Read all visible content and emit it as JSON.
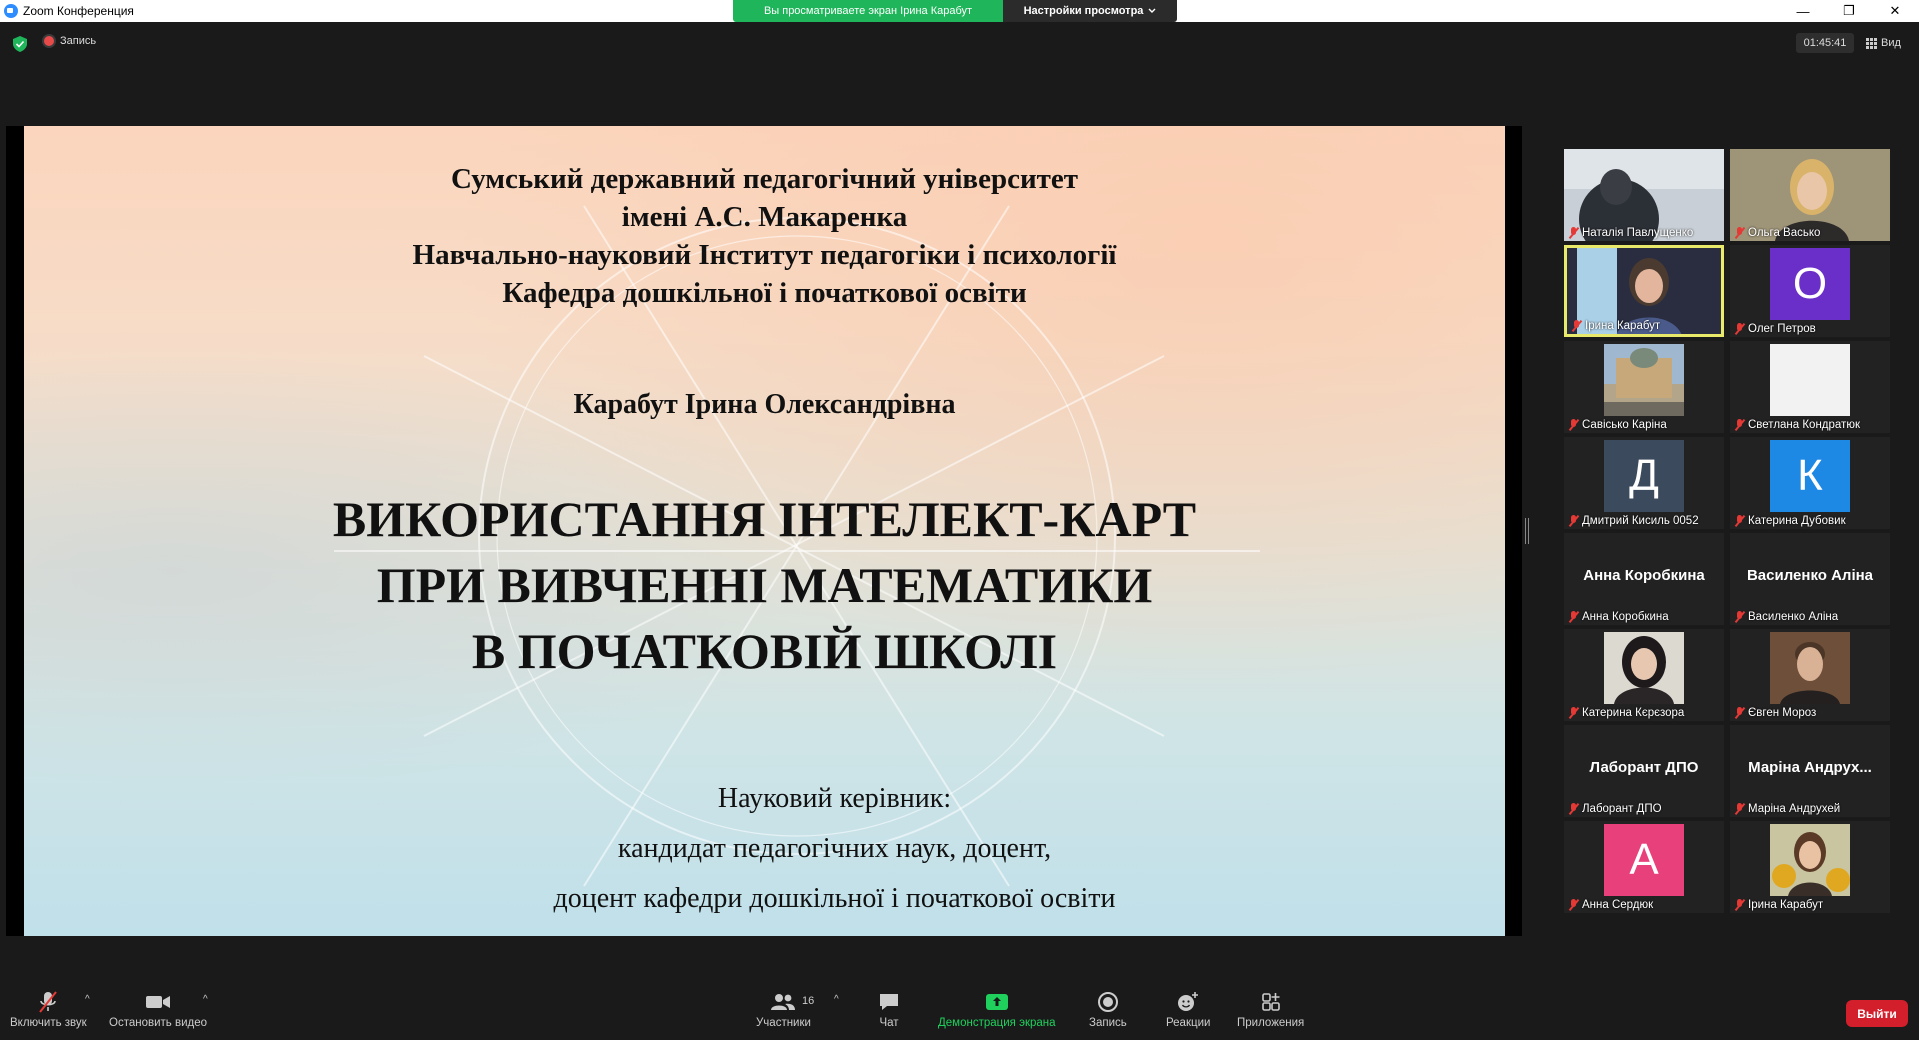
{
  "window": {
    "title": "Zoom Конференция",
    "share_banner": "Вы просматриваете экран Ірина Карабут",
    "view_settings": "Настройки просмотра",
    "minimize": "—",
    "maximize": "❐",
    "close": "✕"
  },
  "topbar": {
    "recording_label": "Запись",
    "timer": "01:45:41",
    "view_label": "Вид"
  },
  "slide": {
    "university_lines": [
      "Сумський державний педагогічний університет",
      "імені А.С. Макаренка",
      "Навчально-науковий Інститут педагогіки і психології",
      "Кафедра дошкільної і початкової освіти"
    ],
    "author": "Карабут Ірина Олександрівна",
    "topic_lines": [
      "ВИКОРИСТАННЯ ІНТЕЛЕКТ-КАРТ",
      "ПРИ ВИВЧЕННІ МАТЕМАТИКИ",
      "В ПОЧАТКОВІЙ ШКОЛІ"
    ],
    "advisor_lines": [
      "Науковий керівник:",
      "кандидат педагогічних наук, доцент,",
      "доцент кафедри дошкільної і початкової освіти"
    ]
  },
  "participants": [
    {
      "name": "Наталія Павлущенко",
      "kind": "photo",
      "photo": "dark-room"
    },
    {
      "name": "Ольга Васько",
      "kind": "photo",
      "photo": "woman-blonde"
    },
    {
      "name": "Ірина Карабут",
      "kind": "photo",
      "photo": "woman-speaking",
      "active": true
    },
    {
      "name": "Олег Петров",
      "kind": "letter",
      "letter": "О",
      "color": "#6a2fc9"
    },
    {
      "name": "Савісько Каріна",
      "kind": "photo",
      "photo": "city-building"
    },
    {
      "name": "Светлана Кондратюк",
      "kind": "blank",
      "color": "#f2f2f2"
    },
    {
      "name": "Дмитрий Кисиль 0052",
      "kind": "letter",
      "letter": "Д",
      "color": "#3b4a5c"
    },
    {
      "name": "Катерина Дубовик",
      "kind": "letter",
      "letter": "К",
      "color": "#1e88e5"
    },
    {
      "name": "Анна Коробкина",
      "kind": "text",
      "center": "Анна Коробкина"
    },
    {
      "name": "Василенко Аліна",
      "kind": "text",
      "center": "Василенко Аліна"
    },
    {
      "name": "Катерина Кєрєзора",
      "kind": "photo",
      "photo": "woman-dark-hair"
    },
    {
      "name": "Євген Мороз",
      "kind": "photo",
      "photo": "man-portrait"
    },
    {
      "name": "Лаборант ДПО",
      "kind": "text",
      "center": "Лаборант ДПО"
    },
    {
      "name": "Маріна Андрухей",
      "kind": "text",
      "center": "Маріна Андрух..."
    },
    {
      "name": "Анна Сердюк",
      "kind": "letter",
      "letter": "А",
      "color": "#e8407a"
    },
    {
      "name": "Ірина Карабут",
      "kind": "photo",
      "photo": "woman-sunflowers"
    }
  ],
  "toolbar": {
    "mute_label": "Включить звук",
    "video_label": "Остановить видео",
    "participants_label": "Участники",
    "participants_count": "16",
    "chat_label": "Чат",
    "share_label": "Демонстрация экрана",
    "record_label": "Запись",
    "reactions_label": "Реакции",
    "apps_label": "Приложения",
    "leave_label": "Выйти",
    "caret": "^"
  },
  "colors": {
    "share_green": "#1fb55a",
    "active_speaker": "#e8e86a",
    "leave_red": "#d21f2b",
    "muted_red": "#e53935"
  }
}
